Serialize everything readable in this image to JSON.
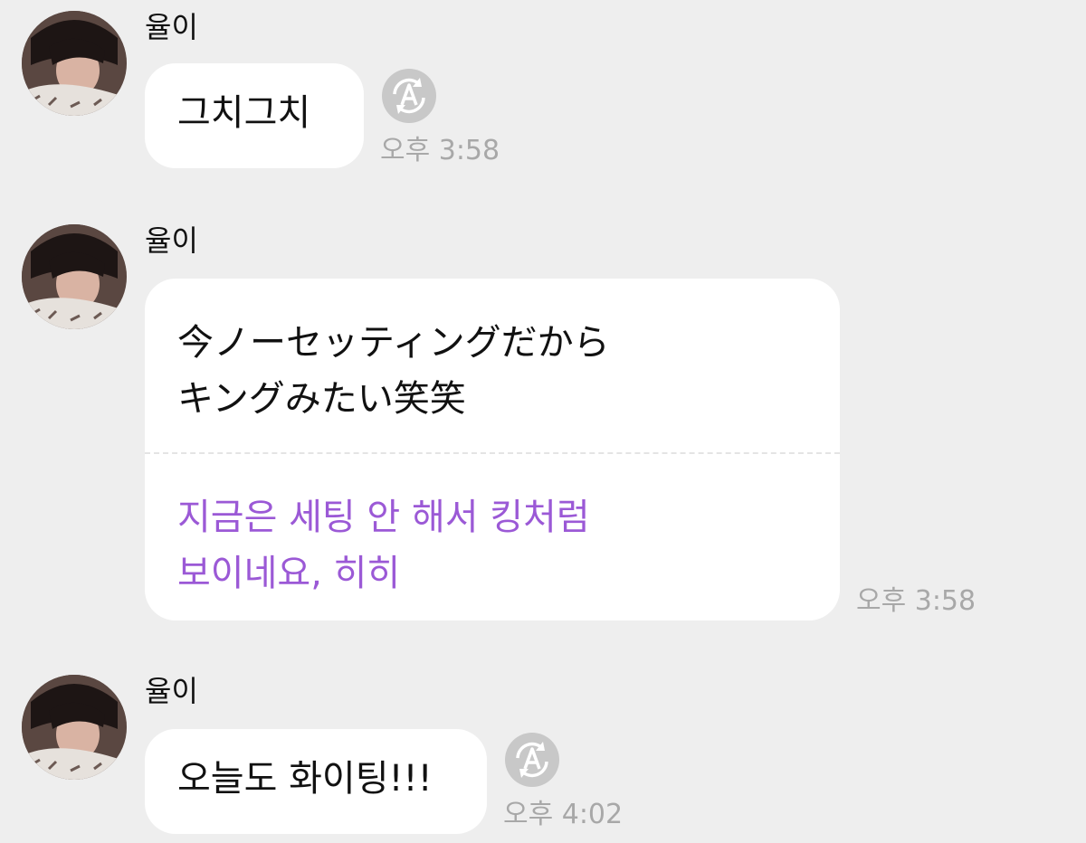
{
  "messages": [
    {
      "sender": "율이",
      "text": "그치그치",
      "time": "오후 3:58",
      "translate_icon": "translate-icon"
    },
    {
      "sender": "율이",
      "original_lines": [
        "今ノーセッティングだから",
        "キングみたい笑笑"
      ],
      "translated_lines": [
        "지금은 세팅 안 해서 킹처럼",
        "보이네요, 히히"
      ],
      "time": "오후 3:58"
    },
    {
      "sender": "율이",
      "text": "오늘도 화이팅!!!",
      "time": "오후 4:02",
      "translate_icon": "translate-icon"
    }
  ],
  "colors": {
    "background": "#eeeeee",
    "bubble": "#ffffff",
    "translation_text": "#9b59d6",
    "time_text": "#a8a8a8"
  }
}
